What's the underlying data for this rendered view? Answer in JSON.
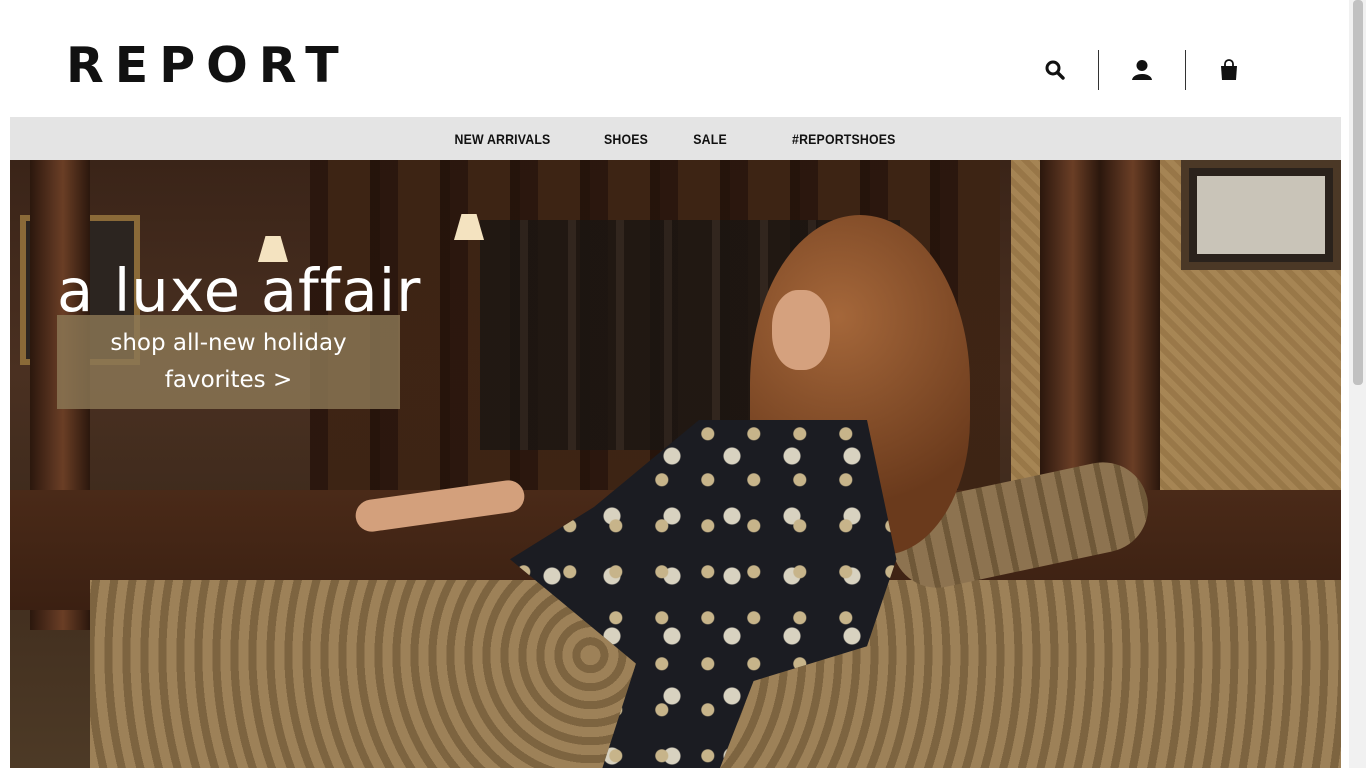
{
  "brand": {
    "logo_text": "REPORT"
  },
  "header": {
    "icons": [
      "search-icon",
      "account-icon",
      "cart-icon"
    ]
  },
  "nav": {
    "items": [
      {
        "label": "NEW ARRIVALS"
      },
      {
        "label": "SHOES"
      },
      {
        "label": "SALE"
      },
      {
        "label": "#REPORTSHOES"
      }
    ]
  },
  "hero": {
    "title": "a luxe affair",
    "cta_label": "shop all-new holiday favorites >"
  },
  "colors": {
    "nav_background": "#e4e4e4",
    "cta_background": "#8b7756",
    "text_dark": "#111111"
  }
}
